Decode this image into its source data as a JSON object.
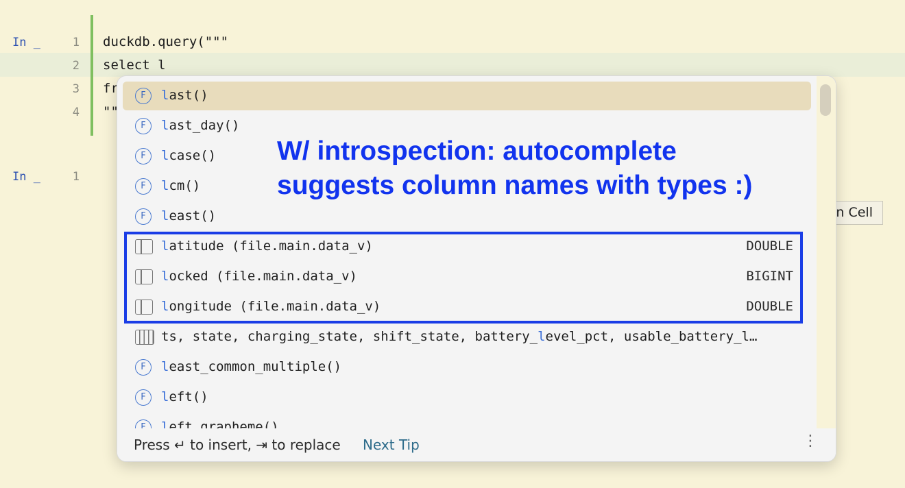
{
  "editor": {
    "cell1": {
      "prompt": "In _",
      "lines": [
        {
          "num": "1",
          "text": "duckdb.query(\"\"\""
        },
        {
          "num": "2",
          "text": "select l"
        },
        {
          "num": "3",
          "text": "fr"
        },
        {
          "num": "4",
          "text": "\"\""
        }
      ]
    },
    "cell2": {
      "prompt": "In _",
      "lines": [
        {
          "num": "1",
          "text": ""
        }
      ]
    },
    "run_cell_button": "n Cell"
  },
  "popup": {
    "items": [
      {
        "icon": "function-icon",
        "prefix": "l",
        "rest": "ast()",
        "type": "",
        "selected": true
      },
      {
        "icon": "function-icon",
        "prefix": "l",
        "rest": "ast_day()",
        "type": ""
      },
      {
        "icon": "function-icon",
        "prefix": "l",
        "rest": "case()",
        "type": ""
      },
      {
        "icon": "function-icon",
        "prefix": "l",
        "rest": "cm()",
        "type": ""
      },
      {
        "icon": "function-icon",
        "prefix": "l",
        "rest": "east()",
        "type": ""
      },
      {
        "icon": "column-icon",
        "prefix": "l",
        "rest": "atitude (file.main.data_v)",
        "type": "DOUBLE"
      },
      {
        "icon": "column-icon",
        "prefix": "l",
        "rest": "ocked (file.main.data_v)",
        "type": "BIGINT"
      },
      {
        "icon": "column-icon",
        "prefix": "l",
        "rest": "ongitude (file.main.data_v)",
        "type": "DOUBLE"
      },
      {
        "icon": "table-icon",
        "before": "ts, state, charging_state, shift_state, battery_",
        "prefix": "l",
        "rest": "evel_pct, usable_battery_l…",
        "type": ""
      },
      {
        "icon": "function-icon",
        "prefix": "l",
        "rest": "east_common_multiple()",
        "type": ""
      },
      {
        "icon": "function-icon",
        "prefix": "l",
        "rest": "eft()",
        "type": ""
      },
      {
        "icon": "function-icon",
        "prefix": "l",
        "rest": "eft_grapheme()",
        "type": ""
      }
    ],
    "footer": {
      "hint": "Press ↵ to insert, ⇥ to replace",
      "next_tip": "Next Tip",
      "more_icon": "⋮"
    }
  },
  "annotation": {
    "line1": "W/ introspection: autocomplete",
    "line2": "suggests column names with types :)"
  }
}
